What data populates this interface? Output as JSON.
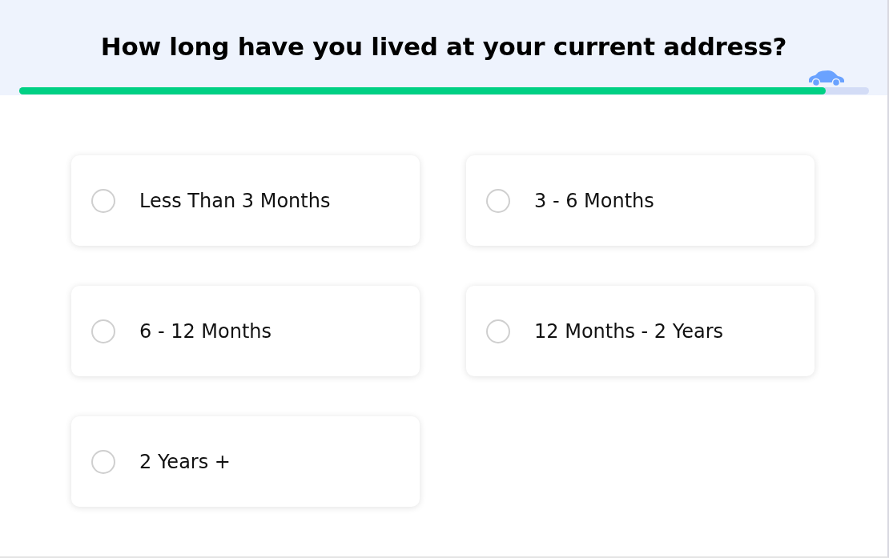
{
  "question": "How long have you lived at your current address?",
  "progress": {
    "level": 0.95
  },
  "options": [
    {
      "label": "Less Than 3 Months",
      "selected": false
    },
    {
      "label": "3 - 6 Months",
      "selected": false
    },
    {
      "label": "6 - 12 Months",
      "selected": false
    },
    {
      "label": "12 Months - 2 Years",
      "selected": false
    },
    {
      "label": "2 Years +",
      "selected": false
    }
  ]
}
